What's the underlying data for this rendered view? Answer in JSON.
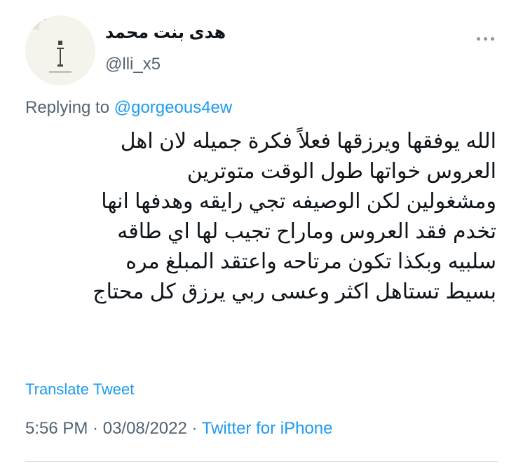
{
  "author": {
    "display_name": "هدى بنت محمد",
    "handle": "@lli_x5"
  },
  "reply": {
    "prefix": "Replying to",
    "to_handle": "@gorgeous4ew"
  },
  "tweet": {
    "lines": [
      "الله يوفقها ويرزقها فعلاً فكرة جميله لان اهل",
      "العروس خواتها طول الوقت متوترين",
      "ومشغولين لكن الوصيفه تجي رايقه وهدفها انها",
      "تخدم فقد العروس وماراح تجيب لها اي طاقه",
      "سلبيه وبكذا تكون مرتاحه واعتقد المبلغ مره",
      "بسيط تستاهل اكثر وعسى ربي يرزق كل محتاج"
    ]
  },
  "translate_label": "Translate Tweet",
  "meta": {
    "time": "5:56 PM",
    "separator1": " · ",
    "date": "03/08/2022",
    "separator2": " · ",
    "source": "Twitter for iPhone"
  },
  "icons": {
    "more": "more-horizontal-icon",
    "avatar": "avatar-logo"
  },
  "colors": {
    "link": "#1d9bf0",
    "secondary_text": "#536471",
    "divider": "#cfd9de"
  }
}
